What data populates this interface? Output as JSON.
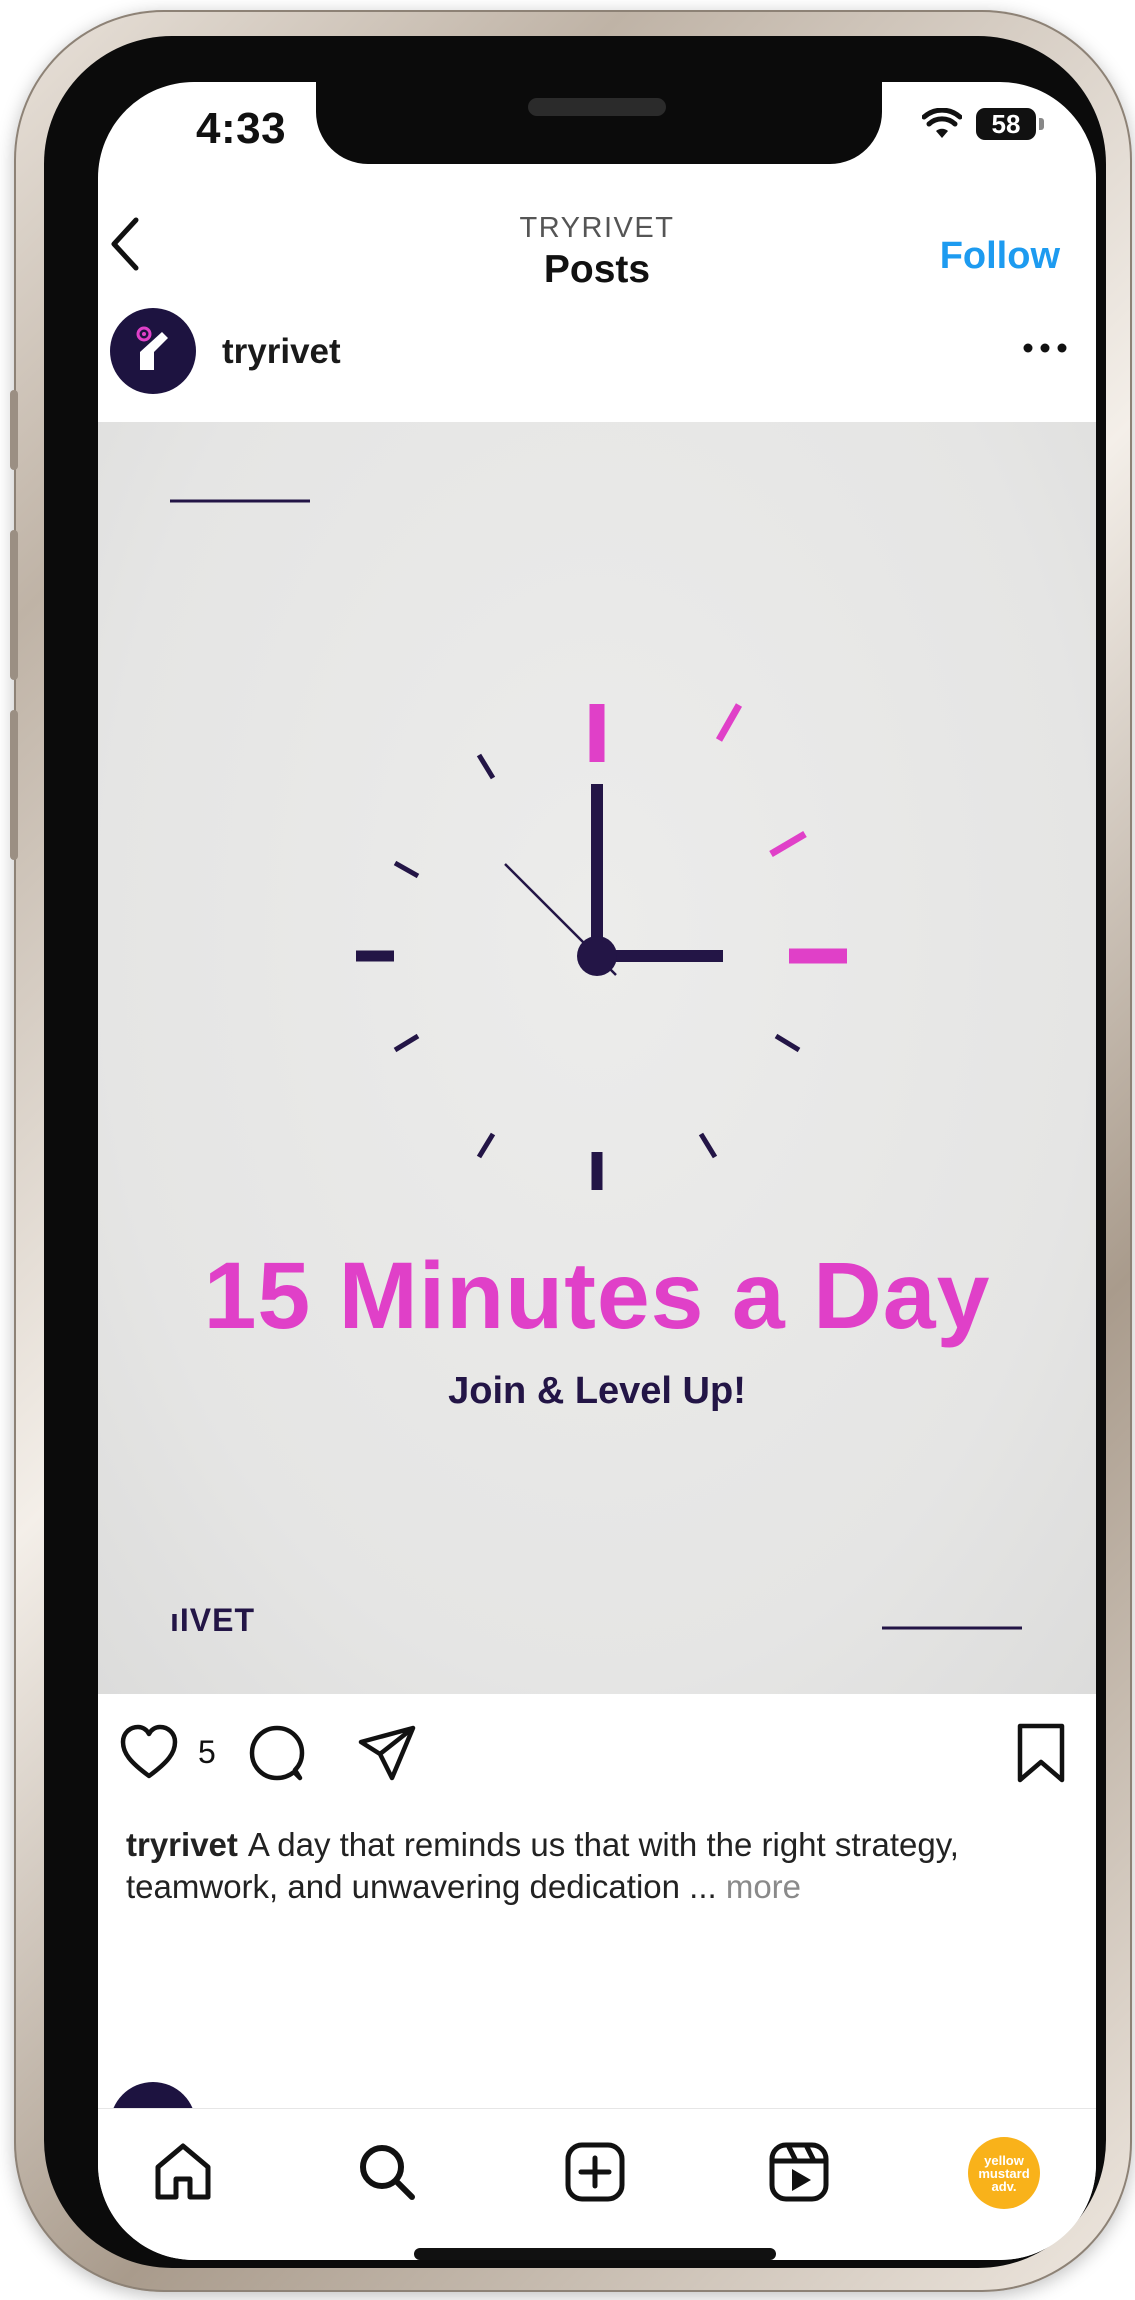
{
  "status_bar": {
    "time": "4:33",
    "battery": "58"
  },
  "header": {
    "account_label": "TRYRIVET",
    "title": "Posts",
    "follow_label": "Follow"
  },
  "post": {
    "username": "tryrivet",
    "image": {
      "headline": "15 Minutes a Day",
      "subhead": "Join & Level Up!",
      "brand_mark": "ıIVET",
      "clock_time": "3:00",
      "colors": {
        "accent": "#e040c8",
        "dark": "#231546"
      }
    },
    "likes": "5",
    "caption": {
      "username": "tryrivet",
      "text": "A day that reminds us that with the right strategy, teamwork, and unwavering dedication ...",
      "more_label": "more"
    }
  },
  "bottom_nav": {
    "items": [
      "home-icon",
      "search-icon",
      "create-icon",
      "reels-icon",
      "profile-avatar"
    ],
    "profile_text": "yellow mustard adv."
  }
}
